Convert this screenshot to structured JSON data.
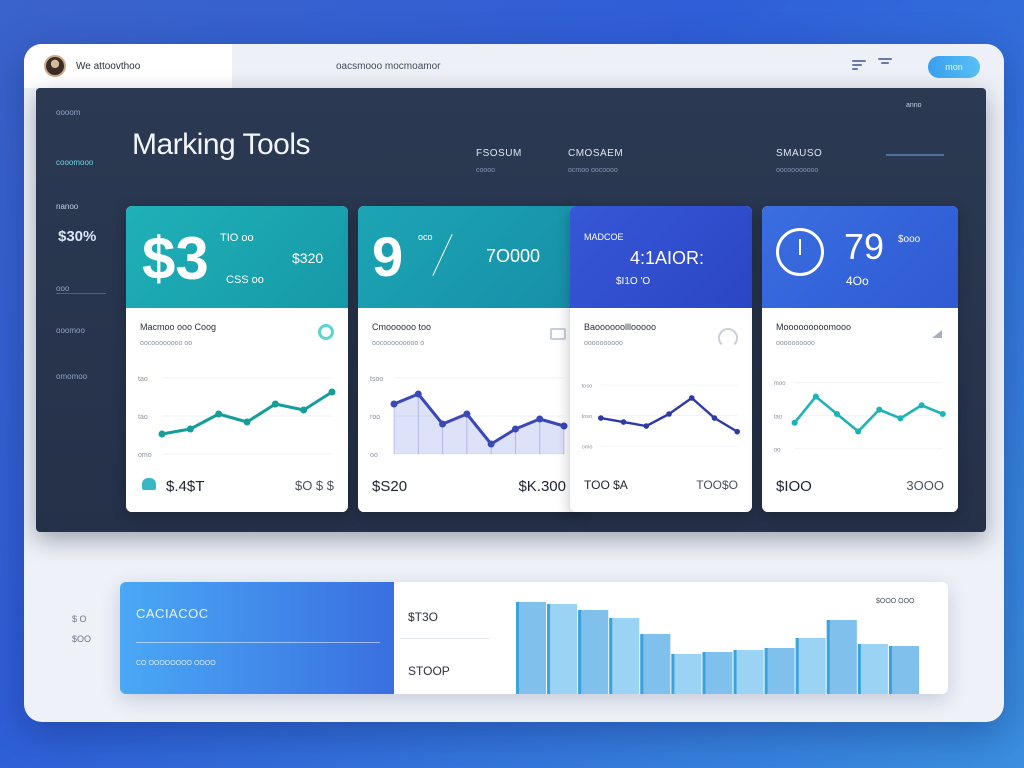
{
  "topbar": {
    "user_name": "We attoovthoo",
    "title": "oacsmooo mocmoamor",
    "button": "mon"
  },
  "header": {
    "title": "Marking Tools",
    "columns": [
      {
        "label": "FSOSUM",
        "sub": "coooo"
      },
      {
        "label": "CMOSAEM",
        "sub": "ocmoo oocoooo"
      },
      {
        "label": "SMAUSO",
        "sub": "oocoooooooo"
      }
    ],
    "top_right": "anno"
  },
  "sidebar": {
    "items": [
      "oooom",
      "cooomooo",
      "nanoo",
      "ooo",
      "ooomoo",
      "omomoo"
    ],
    "highlight": "$30%"
  },
  "cards": [
    {
      "big": "$3",
      "tr": "TIO oo",
      "mid": "$320",
      "small": "CSS oo",
      "body_title": "Macmoo ooo Coog",
      "body_sub": "oocoooooooo oo",
      "foot_left": "$.4$T",
      "foot_right": "$O $ $",
      "chart_points": [
        [
          0,
          60
        ],
        [
          1,
          55
        ],
        [
          2,
          40
        ],
        [
          3,
          48
        ],
        [
          4,
          30
        ],
        [
          5,
          36
        ],
        [
          6,
          18
        ]
      ],
      "y_ticks": [
        "tao",
        "tao",
        "omo"
      ]
    },
    {
      "big": "9",
      "tr": "oco",
      "mid": "7O000",
      "small": "",
      "body_title": "Cmoooooo too",
      "body_sub": "oocooooooooo o",
      "foot_left": "$S20",
      "foot_right": "$K.300",
      "chart_points": [
        [
          0,
          30
        ],
        [
          1,
          20
        ],
        [
          2,
          50
        ],
        [
          3,
          40
        ],
        [
          4,
          70
        ],
        [
          5,
          55
        ],
        [
          6,
          45
        ],
        [
          7,
          52
        ]
      ],
      "y_ticks": [
        "tsoo",
        "roo",
        "oo"
      ]
    },
    {
      "big": "4:1AIOR:",
      "tr": "",
      "mid": "MADCOE",
      "small": "$I1O 'O",
      "body_title": "Baoooooolllooooo",
      "body_sub": "oooooooooo",
      "foot_left": "TOO $A",
      "foot_right": "TOO$O",
      "chart_points": [
        [
          0,
          45
        ],
        [
          1,
          50
        ],
        [
          2,
          55
        ],
        [
          3,
          40
        ],
        [
          4,
          20
        ],
        [
          5,
          45
        ],
        [
          6,
          62
        ]
      ],
      "y_ticks": [
        "toso",
        "toso",
        "omo"
      ]
    },
    {
      "big": "79",
      "tr": "$ooo",
      "mid": "4Oo",
      "small": "",
      "body_title": "Mooooooooomooo",
      "body_sub": "oooooooooo",
      "foot_left": "$IOO",
      "foot_right": "3OOO",
      "chart_points": [
        [
          0,
          50
        ],
        [
          1,
          20
        ],
        [
          2,
          40
        ],
        [
          3,
          60
        ],
        [
          4,
          35
        ],
        [
          5,
          45
        ],
        [
          6,
          30
        ],
        [
          7,
          40
        ]
      ],
      "y_ticks": [
        "moo",
        "tao",
        "oo"
      ]
    }
  ],
  "bottom": {
    "left_title": "CACIACOC",
    "left_sub": "CO OOOOOOOO OOOO",
    "val1": "$T3O",
    "val2": "STOOP",
    "tag": "$OOO OOO",
    "bars": [
      92,
      90,
      84,
      76,
      60,
      40,
      42,
      44,
      46,
      56,
      74,
      50,
      48
    ],
    "outside_left": [
      "$ O",
      "$OO"
    ]
  }
}
